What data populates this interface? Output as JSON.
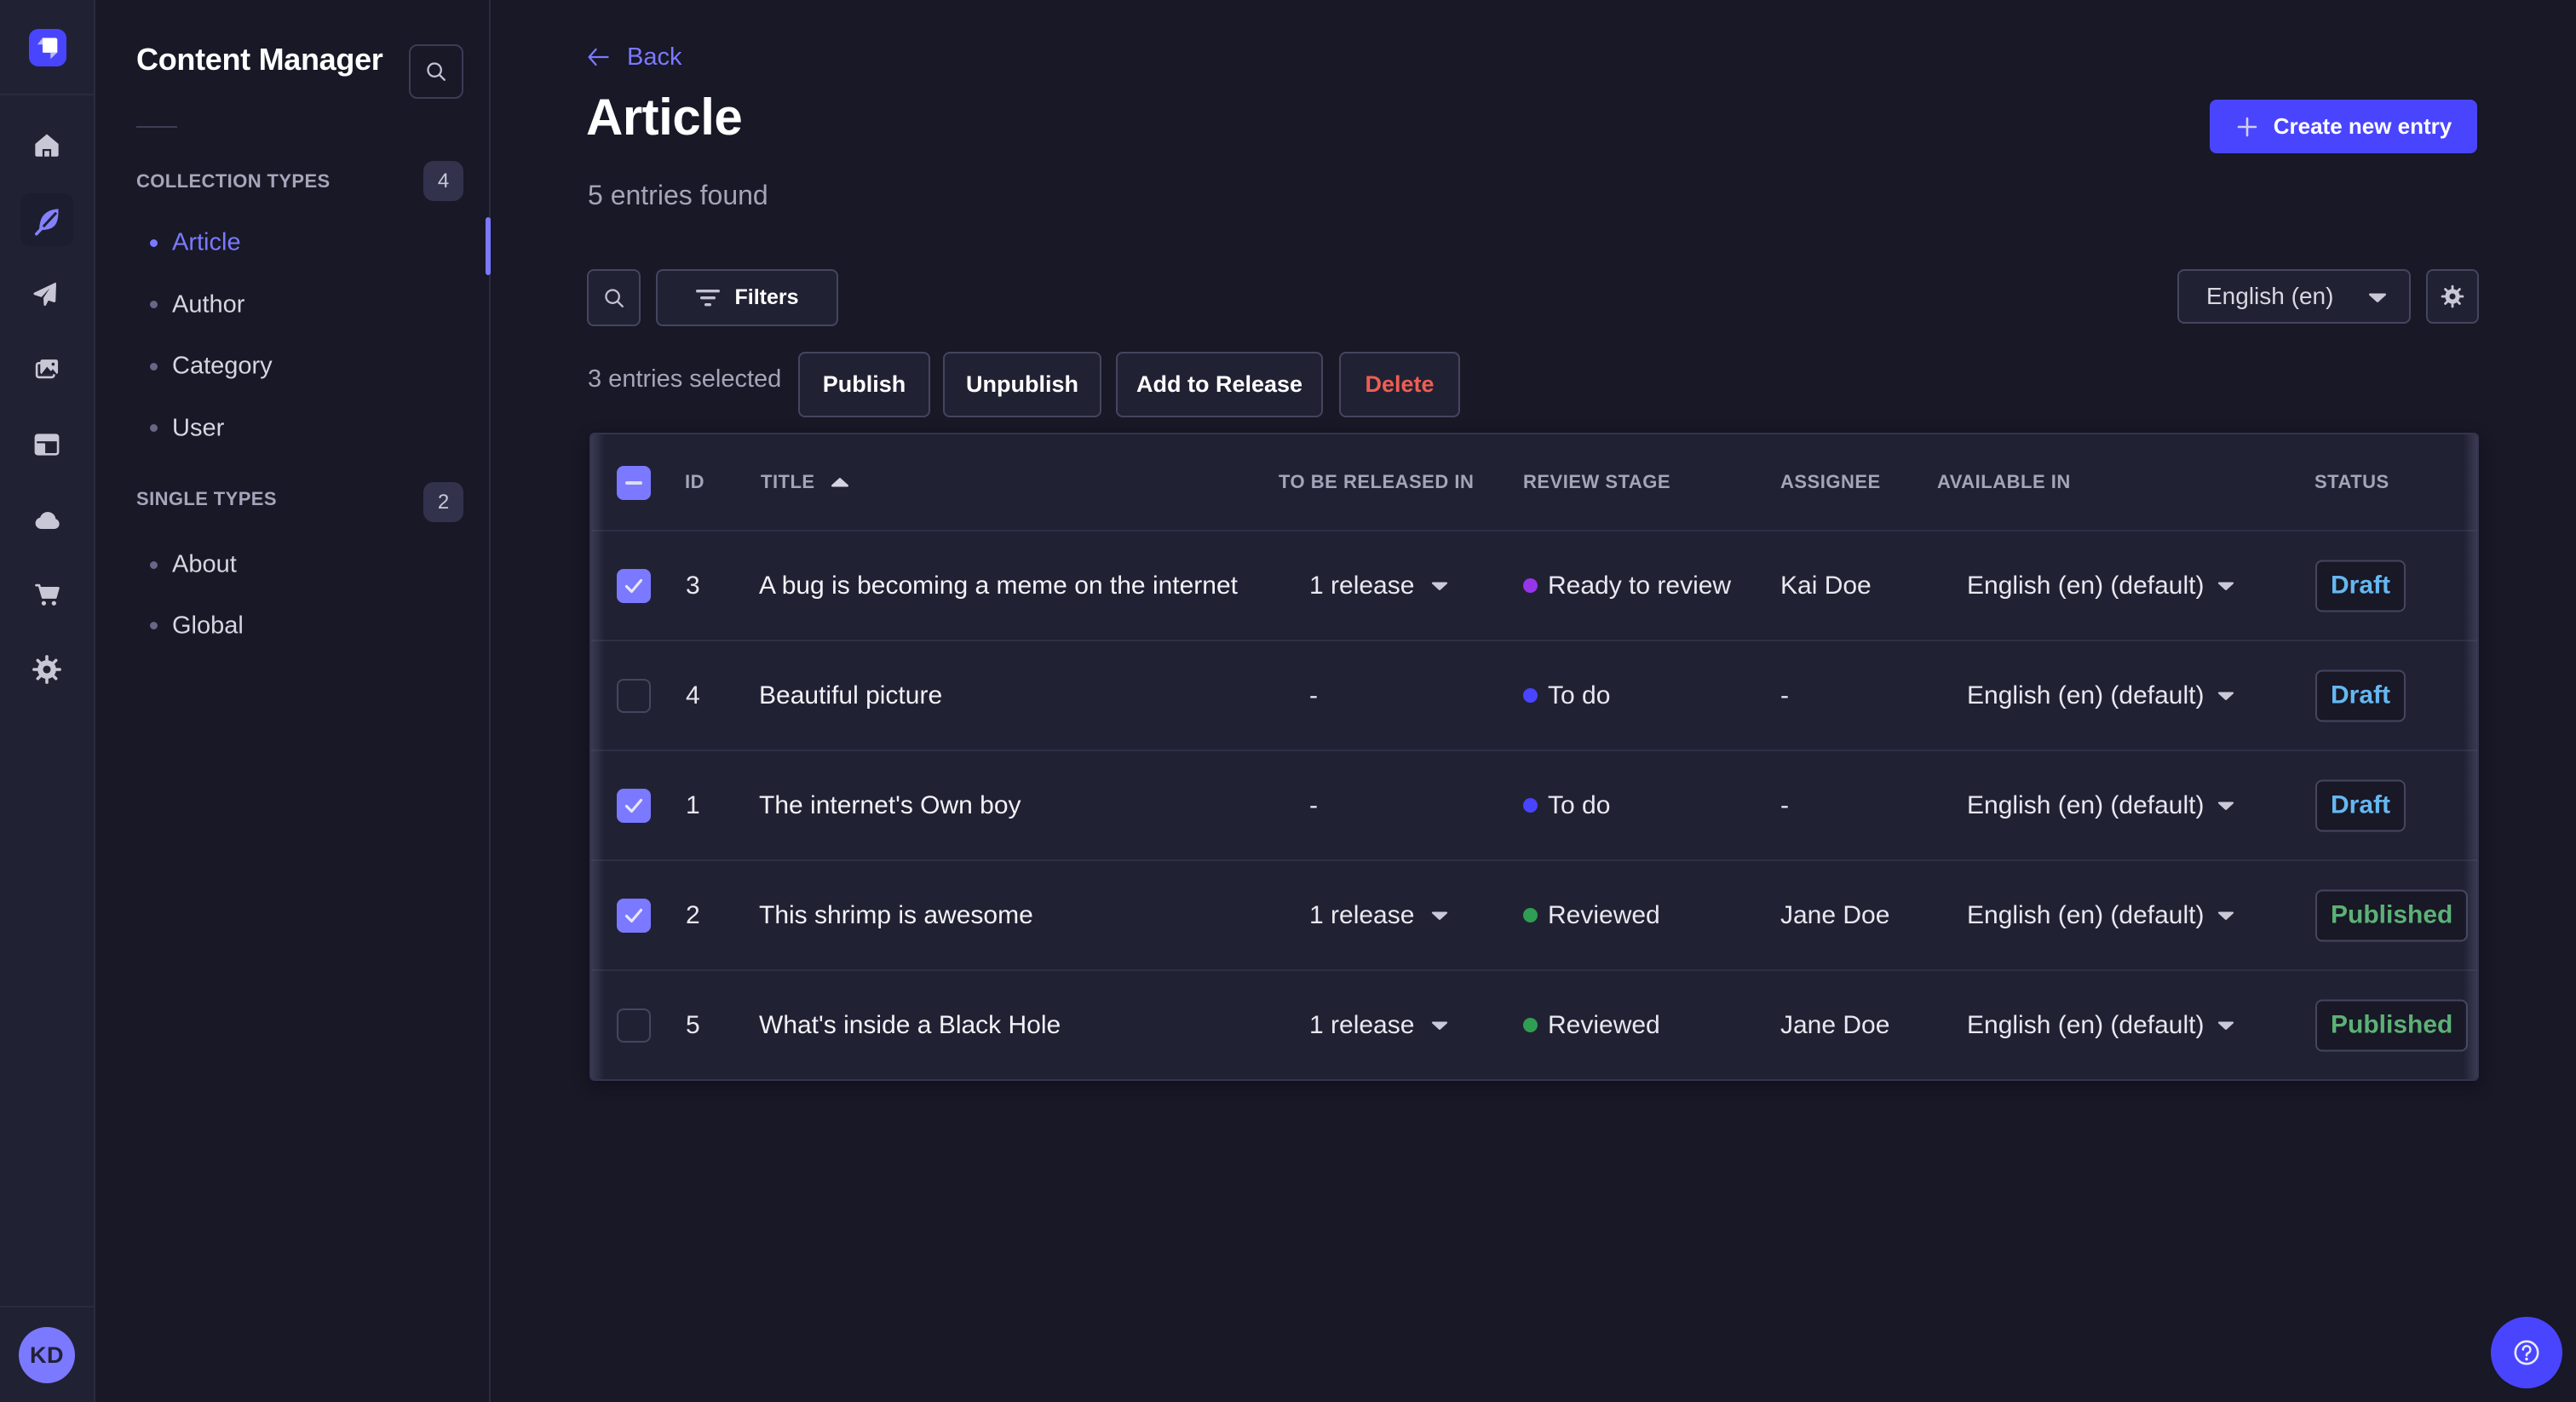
{
  "colors": {
    "bg": "#181826",
    "surface": "#212134",
    "border": "#32324d",
    "border-soft": "#2b2b40",
    "border-strong": "#45455f",
    "accent": "#4945ff",
    "accent-light": "#7b79ff",
    "text-muted": "#a5a5ba",
    "danger": "#ee5e52",
    "draft": "#66b7f1",
    "published": "#5cb176"
  },
  "nav": {
    "logo_icon": "strapi-logo",
    "items": [
      {
        "icon": "home",
        "active": false
      },
      {
        "icon": "feather-pen",
        "active": true
      },
      {
        "icon": "paper-plane",
        "active": false
      },
      {
        "icon": "media-pictures",
        "active": false
      },
      {
        "icon": "layout-panels",
        "active": false
      },
      {
        "icon": "cloud",
        "active": false
      },
      {
        "icon": "shopping-cart",
        "active": false
      },
      {
        "icon": "gear",
        "active": false
      }
    ],
    "avatar_initials": "KD"
  },
  "sidebar": {
    "title": "Content Manager",
    "search_icon": "search",
    "sections": [
      {
        "label": "COLLECTION TYPES",
        "badge": "4",
        "items": [
          {
            "label": "Article",
            "active": true
          },
          {
            "label": "Author",
            "active": false
          },
          {
            "label": "Category",
            "active": false
          },
          {
            "label": "User",
            "active": false
          }
        ]
      },
      {
        "label": "SINGLE TYPES",
        "badge": "2",
        "items": [
          {
            "label": "About",
            "active": false
          },
          {
            "label": "Global",
            "active": false
          }
        ]
      }
    ]
  },
  "header": {
    "back_label": "Back",
    "title": "Article",
    "subtitle": "5 entries found",
    "create_button": "Create new entry"
  },
  "toolbar": {
    "search_icon": "search",
    "filters_label": "Filters",
    "locale_value": "English (en)",
    "settings_icon": "gear"
  },
  "selection": {
    "text": "3 entries selected",
    "actions": [
      {
        "label": "Publish",
        "variant": "default"
      },
      {
        "label": "Unpublish",
        "variant": "default"
      },
      {
        "label": "Add to Release",
        "variant": "default"
      },
      {
        "label": "Delete",
        "variant": "danger"
      }
    ]
  },
  "table": {
    "headers": {
      "id": "ID",
      "title": "TITLE",
      "release": "TO BE RELEASED IN",
      "stage": "REVIEW STAGE",
      "assignee": "ASSIGNEE",
      "available": "AVAILABLE IN",
      "status": "STATUS"
    },
    "sorted_by": "TITLE",
    "sort_direction": "asc",
    "rows": [
      {
        "checked": true,
        "id": "3",
        "title": "A bug is becoming a meme on the internet",
        "release": "1 release",
        "stage": "Ready to review",
        "stage_color": "#9736e8",
        "assignee": "Kai Doe",
        "locale": "English (en) (default)",
        "status": "Draft",
        "status_variant": "draft"
      },
      {
        "checked": false,
        "id": "4",
        "title": "Beautiful picture",
        "release": "-",
        "stage": "To do",
        "stage_color": "#4945ff",
        "assignee": "-",
        "locale": "English (en) (default)",
        "status": "Draft",
        "status_variant": "draft"
      },
      {
        "checked": true,
        "id": "1",
        "title": "The internet's Own boy",
        "release": "-",
        "stage": "To do",
        "stage_color": "#4945ff",
        "assignee": "-",
        "locale": "English (en) (default)",
        "status": "Draft",
        "status_variant": "draft"
      },
      {
        "checked": true,
        "id": "2",
        "title": "This shrimp is awesome",
        "release": "1 release",
        "stage": "Reviewed",
        "stage_color": "#2f9e52",
        "assignee": "Jane Doe",
        "locale": "English (en) (default)",
        "status": "Published",
        "status_variant": "published"
      },
      {
        "checked": false,
        "id": "5",
        "title": "What's inside a Black Hole",
        "release": "1 release",
        "stage": "Reviewed",
        "stage_color": "#2f9e52",
        "assignee": "Jane Doe",
        "locale": "English (en) (default)",
        "status": "Published",
        "status_variant": "published"
      }
    ]
  },
  "help": {
    "icon": "question-mark-circle"
  }
}
